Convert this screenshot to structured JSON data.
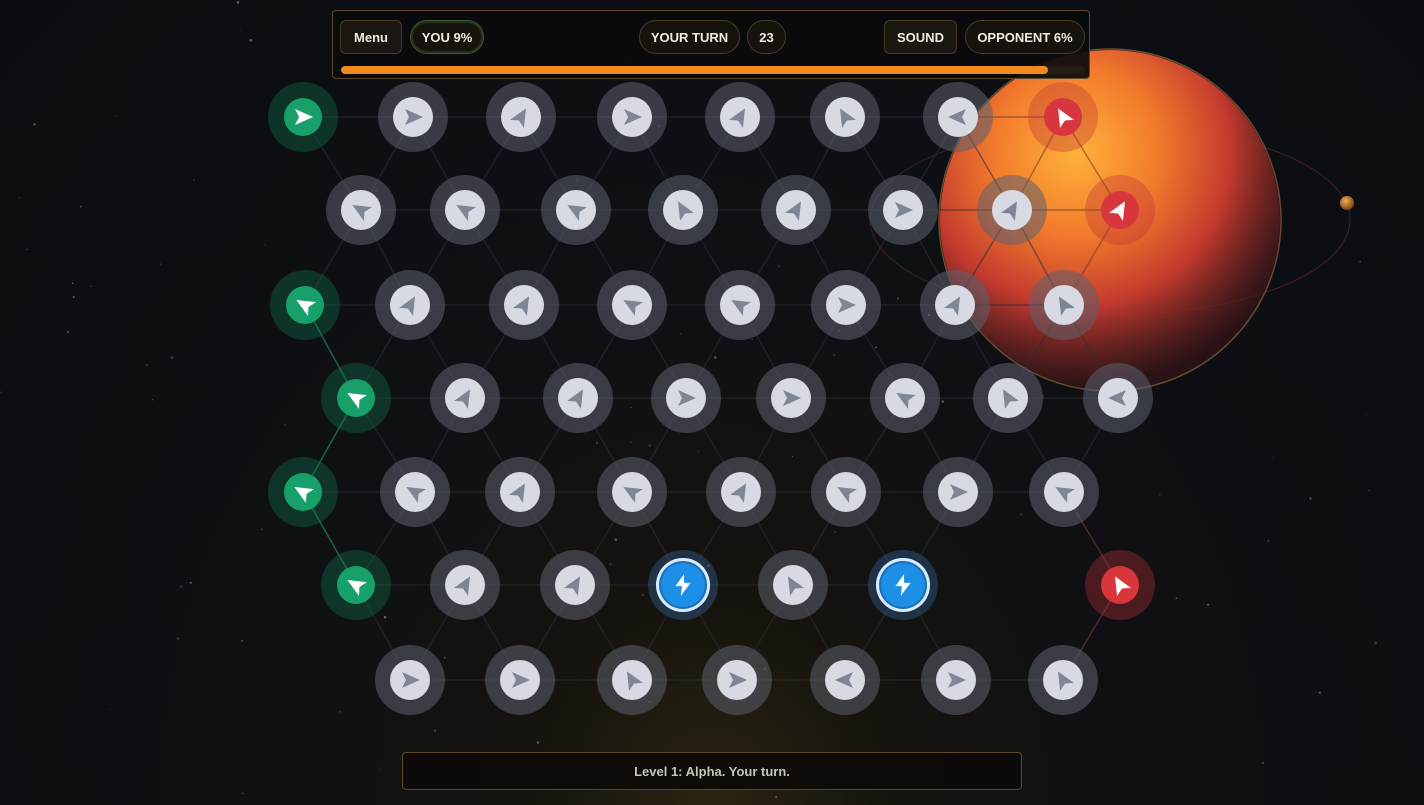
{
  "hud": {
    "menu_label": "Menu",
    "you_label": "YOU 9%",
    "turn_label": "YOUR TURN",
    "turn_count": "23",
    "sound_label": "SOUND",
    "opponent_label": "OPPONENT 6%",
    "progress": 0.95
  },
  "status": {
    "message": "Level 1: Alpha. Your turn."
  },
  "colors": {
    "player": "#17a06a",
    "enemy": "#d6363c",
    "neutral": "#d7dae2",
    "power": "#1e8fe6",
    "progress": "#f08a1c"
  },
  "board": {
    "rows": [
      [
        {
          "type": "player",
          "dir": 0
        },
        {
          "type": "neutral",
          "dir": 0
        },
        {
          "type": "neutral",
          "dir": -60
        },
        {
          "type": "neutral",
          "dir": 0
        },
        {
          "type": "neutral",
          "dir": -60
        },
        {
          "type": "neutral",
          "dir": -120
        },
        {
          "type": "neutral",
          "dir": 180
        },
        {
          "type": "enemy",
          "dir": -120
        }
      ],
      [
        {
          "type": "neutral",
          "dir": -150
        },
        {
          "type": "neutral",
          "dir": -150
        },
        {
          "type": "neutral",
          "dir": -150
        },
        {
          "type": "neutral",
          "dir": -120
        },
        {
          "type": "neutral",
          "dir": -60
        },
        {
          "type": "neutral",
          "dir": 0
        },
        {
          "type": "neutral",
          "dir": -60
        },
        {
          "type": "enemy",
          "dir": -60
        }
      ],
      [
        {
          "type": "player",
          "dir": -150
        },
        {
          "type": "neutral",
          "dir": -60
        },
        {
          "type": "neutral",
          "dir": -60
        },
        {
          "type": "neutral",
          "dir": -150
        },
        {
          "type": "neutral",
          "dir": -150
        },
        {
          "type": "neutral",
          "dir": 0
        },
        {
          "type": "neutral",
          "dir": -60
        },
        {
          "type": "neutral",
          "dir": -120
        }
      ],
      [
        {
          "type": "player",
          "dir": -150
        },
        {
          "type": "neutral",
          "dir": -60
        },
        {
          "type": "neutral",
          "dir": -60
        },
        {
          "type": "neutral",
          "dir": 0
        },
        {
          "type": "neutral",
          "dir": 0
        },
        {
          "type": "neutral",
          "dir": -150
        },
        {
          "type": "neutral",
          "dir": -120
        },
        {
          "type": "neutral",
          "dir": 180
        }
      ],
      [
        {
          "type": "player",
          "dir": -150
        },
        {
          "type": "neutral",
          "dir": -150
        },
        {
          "type": "neutral",
          "dir": -60
        },
        {
          "type": "neutral",
          "dir": -150
        },
        {
          "type": "neutral",
          "dir": -60
        },
        {
          "type": "neutral",
          "dir": -150
        },
        {
          "type": "neutral",
          "dir": 0
        },
        {
          "type": "neutral",
          "dir": -150
        }
      ],
      [
        {
          "type": "player",
          "dir": -150
        },
        {
          "type": "neutral",
          "dir": -60
        },
        {
          "type": "neutral",
          "dir": -60
        },
        {
          "type": "power",
          "dir": 0
        },
        {
          "type": "neutral",
          "dir": -120
        },
        {
          "type": "power",
          "dir": 0
        },
        {
          "type": "empty",
          "dir": 0
        },
        {
          "type": "enemy",
          "dir": -120
        }
      ],
      [
        {
          "type": "empty",
          "dir": 0
        },
        {
          "type": "neutral",
          "dir": 0
        },
        {
          "type": "neutral",
          "dir": 0
        },
        {
          "type": "neutral",
          "dir": -120
        },
        {
          "type": "neutral",
          "dir": 0
        },
        {
          "type": "neutral",
          "dir": 180
        },
        {
          "type": "neutral",
          "dir": 0
        },
        {
          "type": "neutral",
          "dir": -120
        }
      ]
    ]
  }
}
